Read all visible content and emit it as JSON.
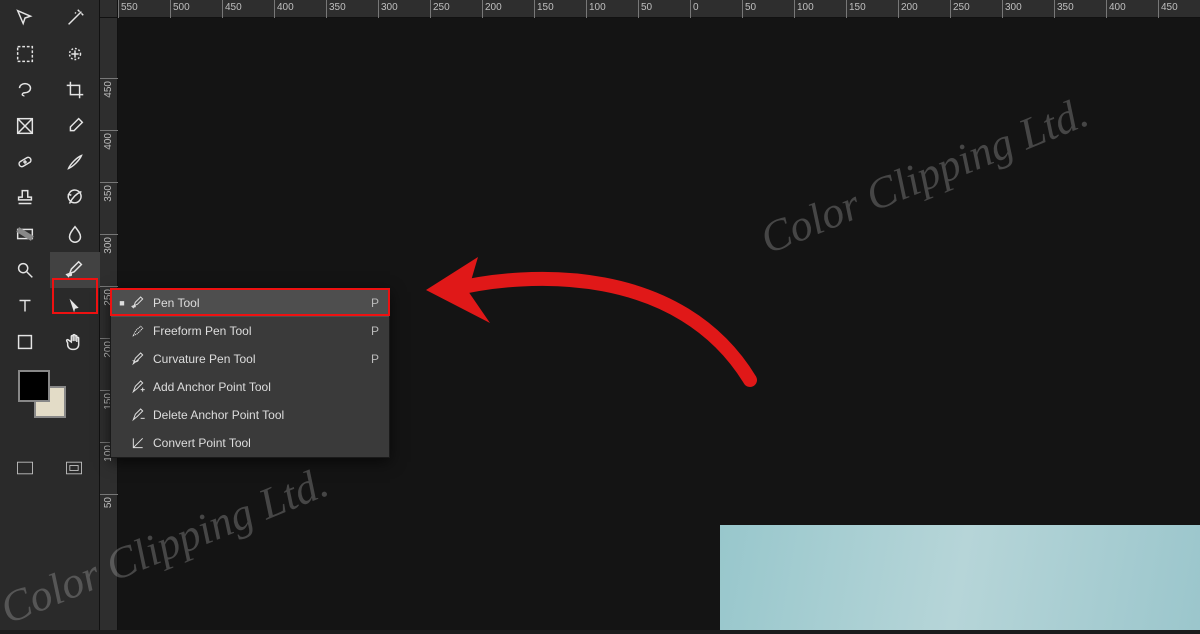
{
  "ruler_h": [
    "550",
    "500",
    "450",
    "400",
    "350",
    "300",
    "250",
    "200",
    "150",
    "100",
    "50",
    "0",
    "50",
    "100",
    "150",
    "200",
    "250",
    "300",
    "350",
    "400",
    "450"
  ],
  "ruler_v": [
    "450",
    "400",
    "350",
    "300",
    "250",
    "200",
    "150",
    "100",
    "50"
  ],
  "tools": [
    {
      "name": "move-tool"
    },
    {
      "name": "wand-tool"
    },
    {
      "name": "marquee-tool"
    },
    {
      "name": "quick-select-tool"
    },
    {
      "name": "lasso-tool"
    },
    {
      "name": "crop-tool"
    },
    {
      "name": "frame-tool"
    },
    {
      "name": "eyedropper-tool"
    },
    {
      "name": "healing-tool"
    },
    {
      "name": "brush-tool"
    },
    {
      "name": "stamp-tool"
    },
    {
      "name": "history-brush-tool"
    },
    {
      "name": "gradient-tool"
    },
    {
      "name": "blur-tool"
    },
    {
      "name": "dodge-tool"
    },
    {
      "name": "pen-tool",
      "active": true
    },
    {
      "name": "type-tool"
    },
    {
      "name": "path-select-tool"
    },
    {
      "name": "shape-tool"
    },
    {
      "name": "hand-tool"
    }
  ],
  "flyout": {
    "items": [
      {
        "label": "Pen Tool",
        "key": "P",
        "selected": true,
        "icon": "pen"
      },
      {
        "label": "Freeform Pen Tool",
        "key": "P",
        "icon": "freeform-pen"
      },
      {
        "label": "Curvature Pen Tool",
        "key": "P",
        "icon": "curvature-pen"
      },
      {
        "label": "Add Anchor Point Tool",
        "key": "",
        "icon": "add-anchor"
      },
      {
        "label": "Delete Anchor Point Tool",
        "key": "",
        "icon": "delete-anchor"
      },
      {
        "label": "Convert Point Tool",
        "key": "",
        "icon": "convert-point"
      }
    ]
  },
  "watermark": "Color Clipping Ltd."
}
